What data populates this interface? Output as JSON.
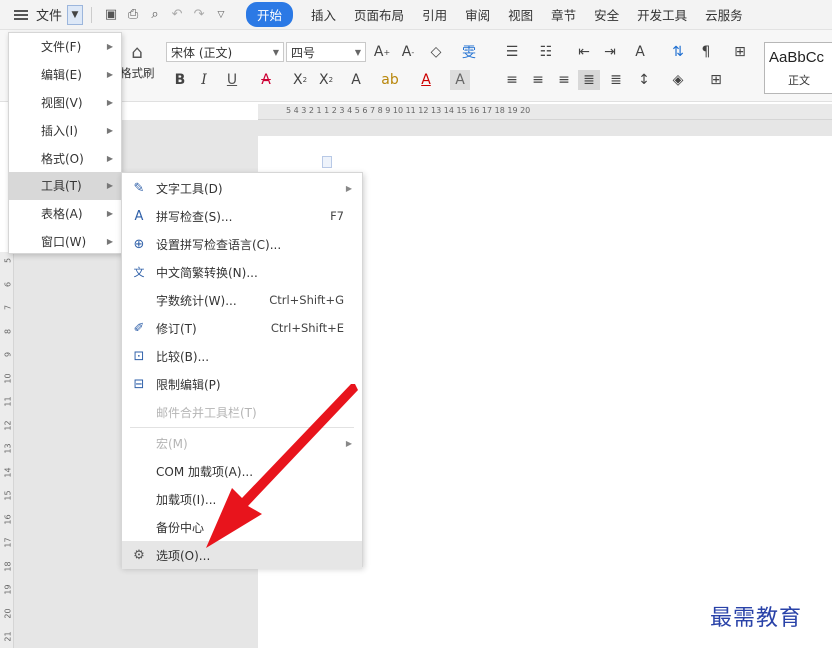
{
  "menubar": {
    "file_label": "文件",
    "tabs": [
      {
        "label": "开始",
        "active": true
      },
      {
        "label": "插入"
      },
      {
        "label": "页面布局"
      },
      {
        "label": "引用"
      },
      {
        "label": "审阅"
      },
      {
        "label": "视图"
      },
      {
        "label": "章节"
      },
      {
        "label": "安全"
      },
      {
        "label": "开发工具"
      },
      {
        "label": "云服务"
      }
    ],
    "accent": "#2b79e5"
  },
  "ribbon": {
    "format_painter_label": "格式刷",
    "font_name": "宋体 (正文)",
    "font_size": "四号",
    "style_preview": "AaBbCc",
    "style_name": "正文"
  },
  "ruler_numbers": "5  4  3  2  1     1  2  3  4  5  6  7  8  9  10  11  12  13  14  15  16  17  18  19  20",
  "vruler_numbers": [
    "5",
    "6",
    "7",
    "8",
    "9",
    "10",
    "11",
    "12",
    "13",
    "14",
    "15",
    "16",
    "17",
    "18",
    "19",
    "20",
    "21"
  ],
  "file_menu": {
    "items": [
      {
        "label": "文件(F)"
      },
      {
        "label": "编辑(E)"
      },
      {
        "label": "视图(V)"
      },
      {
        "label": "插入(I)"
      },
      {
        "label": "格式(O)"
      },
      {
        "label": "工具(T)",
        "highlighted": true
      },
      {
        "label": "表格(A)"
      },
      {
        "label": "窗口(W)"
      }
    ]
  },
  "tools_menu": {
    "items": [
      {
        "label": "文字工具(D)",
        "icon": "text-tool-icon",
        "submenu": true
      },
      {
        "label": "拼写检查(S)...",
        "icon": "spell-check-icon",
        "shortcut": "F7"
      },
      {
        "label": "设置拼写检查语言(C)...",
        "icon": "globe-icon"
      },
      {
        "label": "中文简繁转换(N)...",
        "icon": "chinese-convert-icon"
      },
      {
        "label": "字数统计(W)...",
        "shortcut": "Ctrl+Shift+G"
      },
      {
        "label": "修订(T)",
        "icon": "track-changes-icon",
        "shortcut": "Ctrl+Shift+E"
      },
      {
        "label": "比较(B)...",
        "icon": "compare-icon"
      },
      {
        "label": "限制编辑(P)",
        "icon": "restrict-edit-icon"
      },
      {
        "label": "邮件合并工具栏(T)",
        "disabled": true
      },
      {
        "label": "宏(M)",
        "disabled": true,
        "submenu": true
      },
      {
        "label": "COM 加载项(A)..."
      },
      {
        "label": "加载项(I)..."
      },
      {
        "label": "备份中心"
      },
      {
        "label": "选项(O)...",
        "icon": "gear-icon",
        "highlighted": true
      }
    ]
  },
  "annotation": {
    "color": "#e8141c"
  },
  "watermark": "最需教育"
}
